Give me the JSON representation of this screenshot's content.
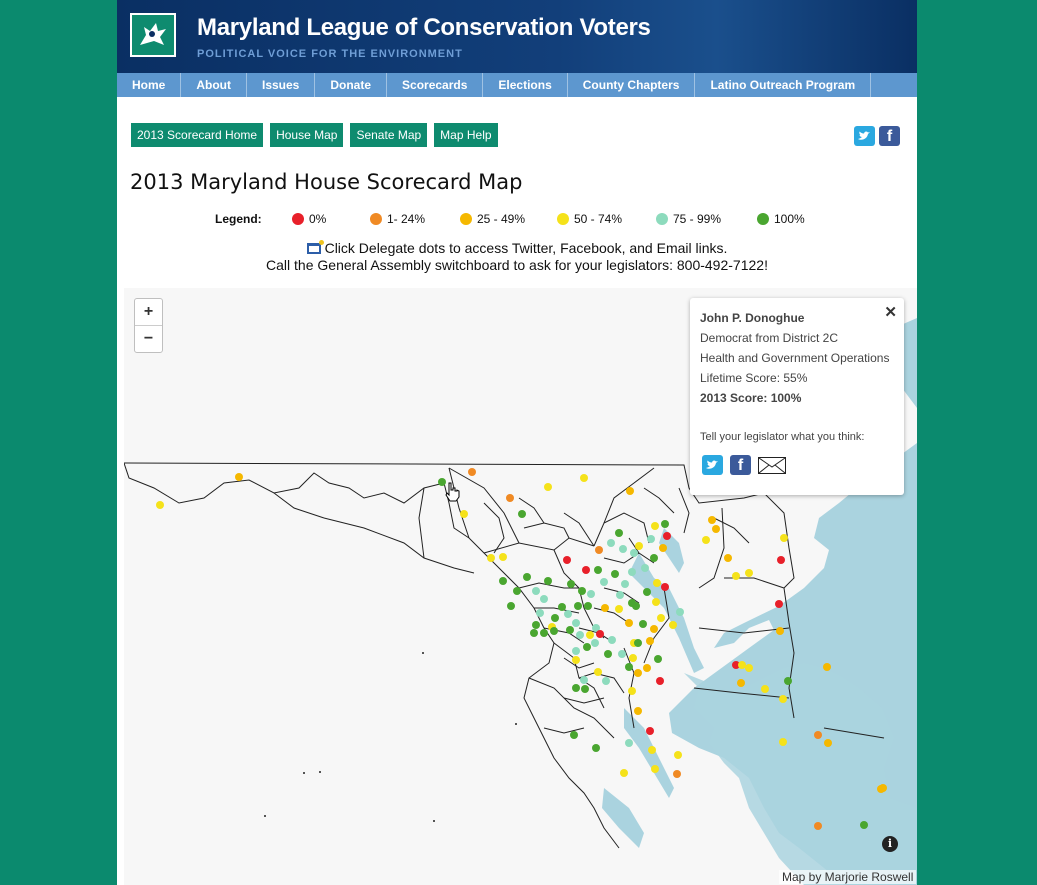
{
  "header": {
    "title": "Maryland League of Conservation Voters",
    "tagline": "POLITICAL VOICE FOR THE ENVIRONMENT",
    "logo_icon": "heron-logo-icon"
  },
  "nav": [
    "Home",
    "About",
    "Issues",
    "Donate",
    "Scorecards",
    "Elections",
    "County Chapters",
    "Latino Outreach Program"
  ],
  "subnav": [
    "2013 Scorecard Home",
    "House Map",
    "Senate Map",
    "Map Help"
  ],
  "social": {
    "twitter_icon": "twitter-icon",
    "facebook_icon": "facebook-icon",
    "facebook_glyph": "f"
  },
  "page_title": "2013 Maryland House Scorecard Map",
  "legend": {
    "label": "Legend:",
    "items": [
      {
        "label": "0%",
        "color": "#e8202a"
      },
      {
        "label": "1- 24%",
        "color": "#f08a24"
      },
      {
        "label": "25 - 49%",
        "color": "#f5b800"
      },
      {
        "label": "50 - 74%",
        "color": "#f5e21a"
      },
      {
        "label": "75 - 99%",
        "color": "#8ddbbd"
      },
      {
        "label": "100%",
        "color": "#4aa630"
      }
    ]
  },
  "instructions": {
    "line1": "Click Delegate dots to access Twitter, Facebook, and Email links.",
    "line2": "Call the General Assembly switchboard to ask for your legislators: 800-492-7122!"
  },
  "map": {
    "zoom_in": "+",
    "zoom_out": "−",
    "water_color": "#aad3df",
    "land_color": "#f7f7f7",
    "info_glyph": "i",
    "attribution": "Map by Marjorie Roswell"
  },
  "popup": {
    "close": "✕",
    "name": "John P. Donoghue",
    "party_district": "Democrat from District 2C",
    "committee": "Health and Government Operations",
    "lifetime": "Lifetime Score: 55%",
    "score_2013": "2013 Score: 100%",
    "prompt": "Tell your legislator what you think:"
  }
}
